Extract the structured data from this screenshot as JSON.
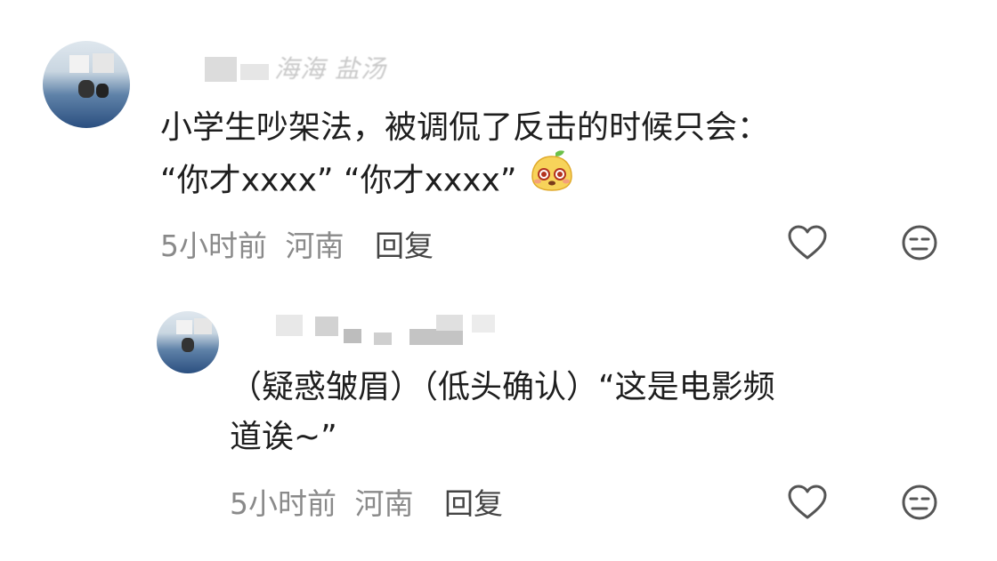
{
  "comments": [
    {
      "username": "海海 盐汤",
      "content_line1": "小学生吵架法，被调侃了反击的时候只会：",
      "content_line2": "“你才xxxx” “你才xxxx”",
      "emoji": "mango-face-emoji",
      "time": "5小时前",
      "location": "河南",
      "reply_label": "回复"
    },
    {
      "username": "",
      "content_line1": "（疑惑皱眉）（低头确认）“这是电影频",
      "content_line2": "道诶~”",
      "time": "5小时前",
      "location": "河南",
      "reply_label": "回复"
    }
  ],
  "icons": {
    "like": "heart-outline-icon",
    "dislike": "meh-face-icon"
  },
  "colors": {
    "text": "#1e1e1e",
    "meta": "#8a8a8a",
    "reply": "#444444",
    "icon": "#555555"
  }
}
